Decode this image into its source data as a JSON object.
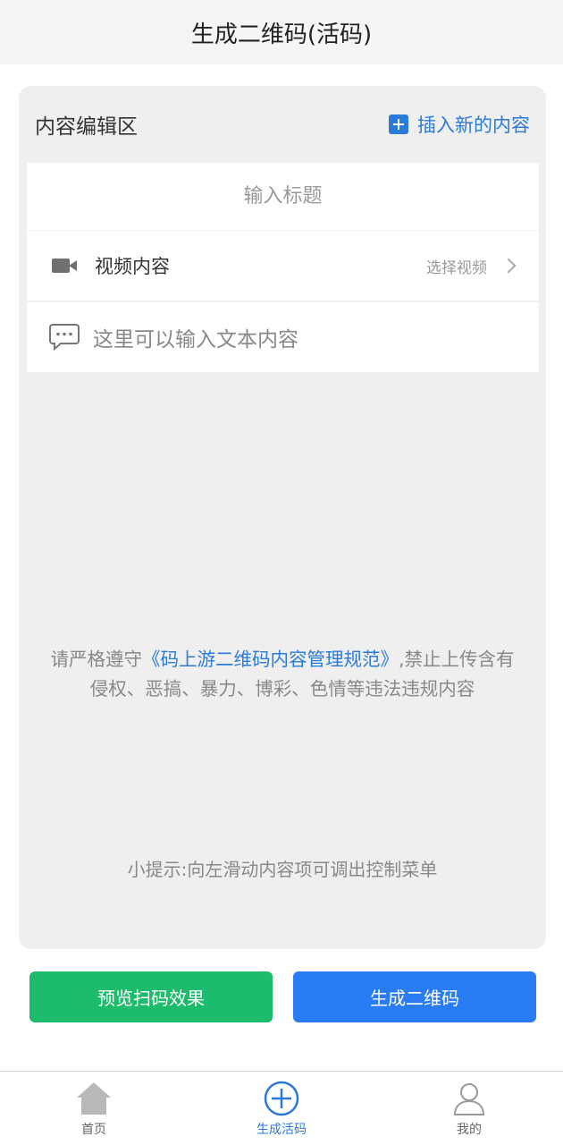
{
  "header": {
    "title": "生成二维码(活码)"
  },
  "editor": {
    "title": "内容编辑区",
    "insert_label": "插入新的内容",
    "title_placeholder": "输入标题",
    "video_row": {
      "label": "视频内容",
      "select_label": "选择视频"
    },
    "text_row": {
      "placeholder": "这里可以输入文本内容"
    }
  },
  "notice": {
    "prefix": "请严格遵守",
    "link": "《码上游二维码内容管理规范》",
    "suffix": ",禁止上传含有侵权、恶搞、暴力、博彩、色情等违法违规内容"
  },
  "tip": "小提示:向左滑动内容项可调出控制菜单",
  "buttons": {
    "preview": "预览扫码效果",
    "generate": "生成二维码"
  },
  "tabbar": {
    "items": [
      {
        "label": "首页",
        "icon": "home-icon",
        "active": false
      },
      {
        "label": "生成活码",
        "icon": "plus-circle-icon",
        "active": true
      },
      {
        "label": "我的",
        "icon": "user-icon",
        "active": false
      }
    ]
  },
  "colors": {
    "accent": "#2a7ad8",
    "green": "#1dbb6c",
    "blue": "#2a7cf5"
  }
}
